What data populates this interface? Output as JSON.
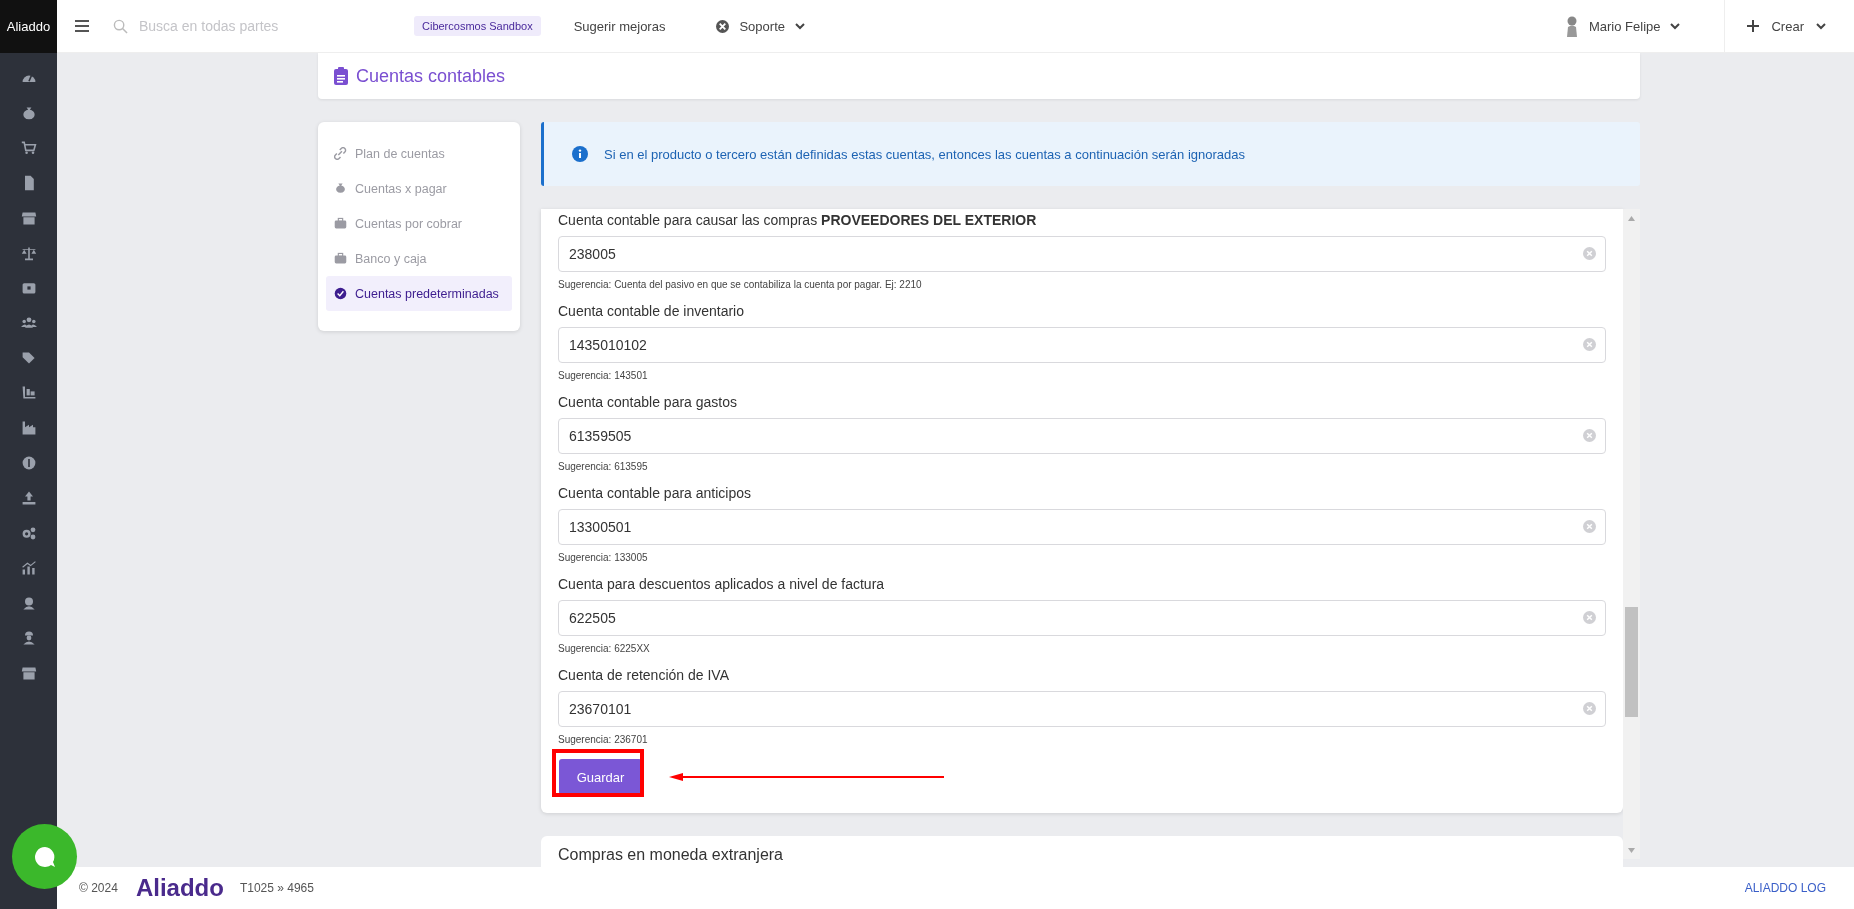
{
  "app": {
    "logo": "Aliaddo"
  },
  "topbar": {
    "search": {
      "placeholder": "Busca en todas partes"
    },
    "environment_badge": "Cibercosmos Sandbox",
    "link": "Sugerir mejoras",
    "support": "Soporte",
    "user": "Mario Felipe",
    "create": "Crear"
  },
  "page": {
    "title": "Cuentas contables"
  },
  "nav": [
    {
      "label": "Plan de cuentas",
      "selected": false
    },
    {
      "label": "Cuentas x pagar",
      "selected": false
    },
    {
      "label": "Cuentas por cobrar",
      "selected": false
    },
    {
      "label": "Banco y caja",
      "selected": false
    },
    {
      "label": "Cuentas predeterminadas",
      "selected": true
    }
  ],
  "info": "Si en el producto o tercero están definidas estas cuentas, entonces las cuentas a continuación serán ignoradas",
  "fields": [
    {
      "label": "Cuenta contable para causar las compras **PROVEEDORES DEL EXTERIOR**",
      "value": "238005",
      "hint": "Sugerencia: Cuenta del pasivo en que se contabiliza la cuenta por pagar. Ej: 2210"
    },
    {
      "label": "Cuenta contable de inventario",
      "value": "1435010102",
      "hint": "Sugerencia: 143501"
    },
    {
      "label": "Cuenta contable para gastos",
      "value": "61359505",
      "hint": "Sugerencia: 613595"
    },
    {
      "label": "Cuenta contable para anticipos",
      "value": "13300501",
      "hint": "Sugerencia: 133005"
    },
    {
      "label": "Cuenta para descuentos aplicados a nivel de factura",
      "value": "622505",
      "hint": "Sugerencia: 6225XX"
    },
    {
      "label": "Cuenta de retención de IVA",
      "value": "23670101",
      "hint": "Sugerencia: 236701"
    }
  ],
  "save_button": "Guardar",
  "next_section": {
    "title": "Compras en moneda extranjera"
  },
  "footer": {
    "copyright": "© 2024",
    "logo": "Aliaddo",
    "version": "T1025 » 4965",
    "link": "ALIADDO LOG"
  }
}
